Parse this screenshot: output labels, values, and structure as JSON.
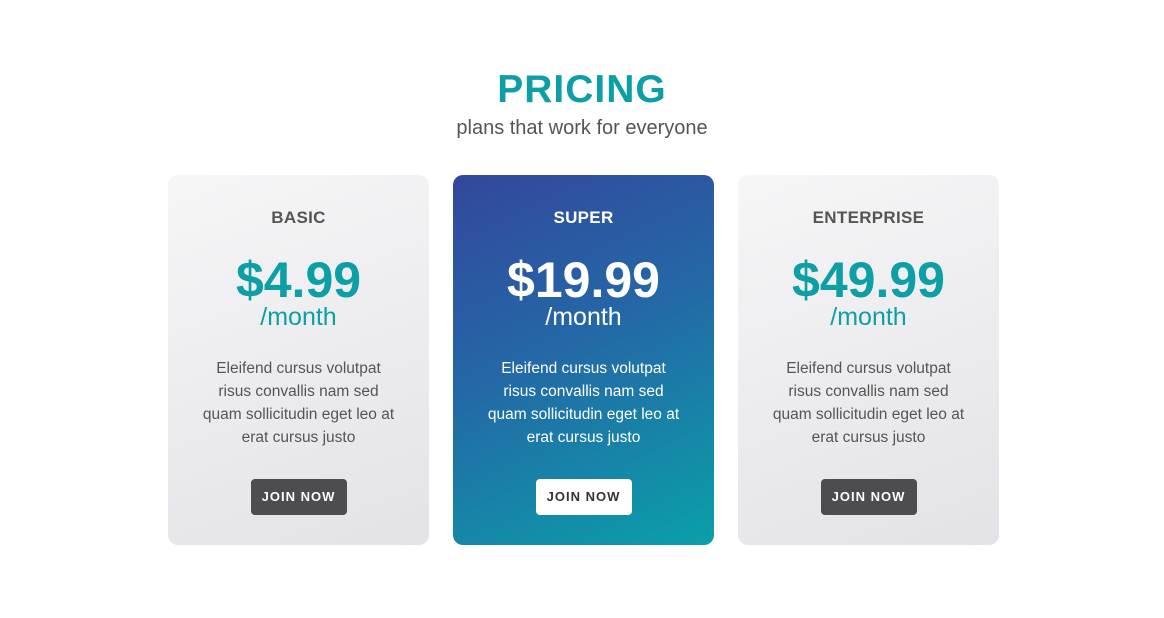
{
  "header": {
    "title": "PRICING",
    "subtitle": "plans that work for everyone"
  },
  "plans": [
    {
      "name": "BASIC",
      "price": "$4.99",
      "period": "/month",
      "description": "Eleifend cursus volutpat risus convallis nam sed quam sollicitudin eget leo at erat cursus justo",
      "button_label": "JOIN NOW"
    },
    {
      "name": "SUPER",
      "price": "$19.99",
      "period": "/month",
      "description": "Eleifend cursus volutpat risus convallis nam sed quam sollicitudin eget leo at erat cursus justo",
      "button_label": "JOIN NOW"
    },
    {
      "name": "ENTERPRISE",
      "price": "$49.99",
      "period": "/month",
      "description": "Eleifend cursus volutpat risus convallis nam sed quam sollicitudin eget leo at erat cursus justo",
      "button_label": "JOIN NOW"
    }
  ],
  "colors": {
    "accent": "#0d9fa6",
    "featured_gradient_start": "#33479d",
    "featured_gradient_end": "#0aa0a9",
    "button": "#4d4d4f"
  }
}
